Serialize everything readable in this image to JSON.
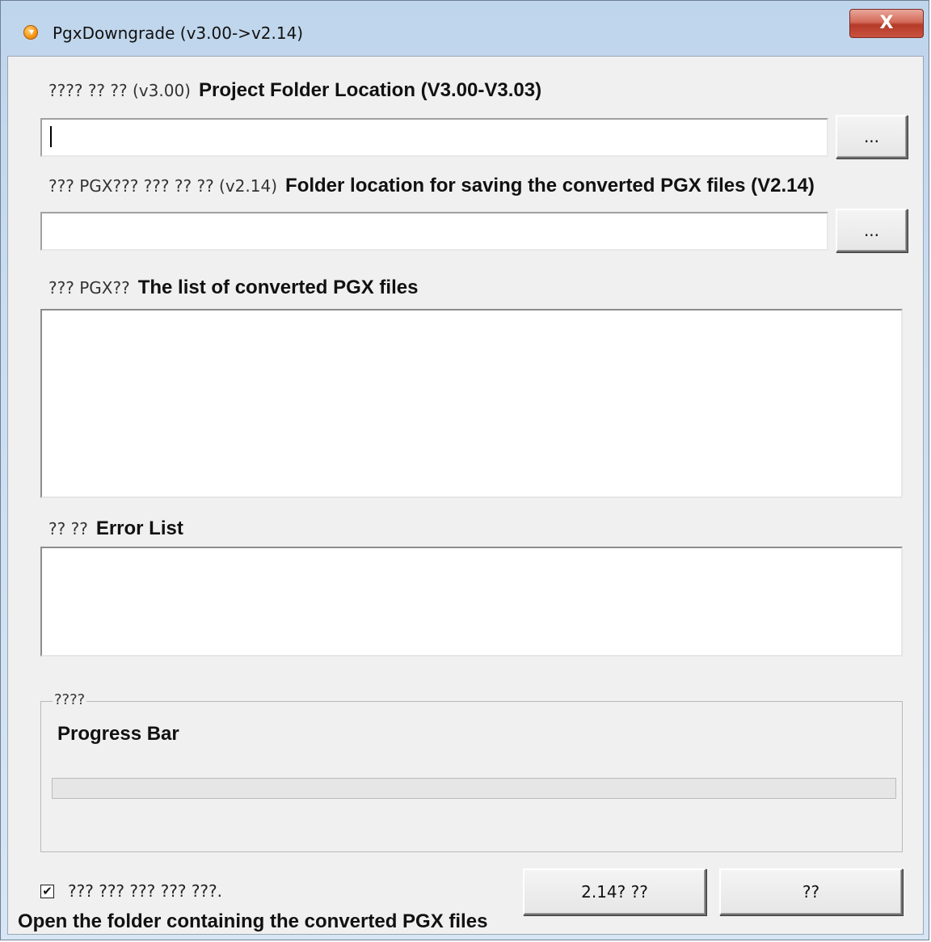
{
  "window": {
    "title": "PgxDowngrade (v3.00->v2.14)",
    "close_symbol": "X"
  },
  "project_folder": {
    "label_ko": "???? ?? ?? (v3.00)",
    "label_en": "Project Folder Location (V3.00-V3.03)",
    "value": "",
    "browse_label": "..."
  },
  "save_folder": {
    "label_ko": "??? PGX??? ??? ?? ?? (v2.14)",
    "label_en": "Folder location for saving the converted PGX files (V2.14)",
    "value": "",
    "browse_label": "..."
  },
  "converted_list": {
    "label_ko": "??? PGX??",
    "label_en": "The list of converted PGX files",
    "items": []
  },
  "error_list": {
    "label_ko": "?? ??",
    "label_en": "Error List",
    "items": []
  },
  "progress": {
    "group_label": "????",
    "label_en": "Progress Bar",
    "percent": 0
  },
  "open_folder": {
    "checked": true,
    "check_mark": "✔",
    "label_ko": "??? ??? ??? ??? ???.",
    "label_en": "Open the folder containing the converted PGX files"
  },
  "buttons": {
    "convert_label": "2.14? ??",
    "close_label": "??"
  },
  "icons": {
    "app": "app-orange-icon",
    "close": "close-icon"
  }
}
